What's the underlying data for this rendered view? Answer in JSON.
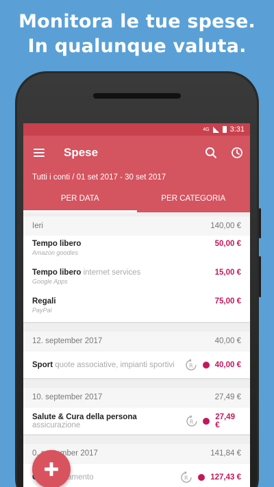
{
  "promo": {
    "line1": "Monitora le tue spese.",
    "line2": "In qualunque valuta."
  },
  "status": {
    "network": "4G",
    "time": "3:31"
  },
  "toolbar": {
    "title": "Spese",
    "subtitle": "Tutti i conti / 01 set 2017 - 30 set 2017"
  },
  "tabs": [
    {
      "label": "PER DATA",
      "active": true
    },
    {
      "label": "PER CATEGORIA",
      "active": false
    }
  ],
  "groups": [
    {
      "date": "Ieri",
      "total": "140,00 €",
      "items": [
        {
          "category": "Tempo libero",
          "description": "",
          "account": "Amazon goodies",
          "amount": "50,00 €"
        },
        {
          "category": "Tempo libero",
          "description": "internet services",
          "account": "Google Apps",
          "amount": "15,00 €"
        },
        {
          "category": "Regali",
          "description": "",
          "account": "PayPal",
          "amount": "75,00 €"
        }
      ]
    },
    {
      "date": "12. september 2017",
      "total": "40,00 €",
      "items": [
        {
          "category": "Sport",
          "description": "quote associative, impianti sportivi",
          "amount": "40,00 €"
        }
      ]
    },
    {
      "date": "10. september 2017",
      "total": "27,49 €",
      "items": [
        {
          "category": "Salute & Cura della persona",
          "description": "assicurazione",
          "amount": "27,49 €"
        }
      ]
    },
    {
      "date": "0. september 2017",
      "total": "141,84 €",
      "items": [
        {
          "category": "Ca",
          "description": "riscaldamento",
          "amount": "127,43 €"
        }
      ]
    }
  ],
  "colors": {
    "appbar": "#d45460",
    "statusbar": "#c9414d",
    "amount": "#c2185b",
    "background": "#5aa0d6",
    "fab": "#d9535f"
  },
  "icons": {
    "menu": "hamburger-icon",
    "search": "search-icon",
    "history": "clock-icon",
    "recurring": "recurring-icon",
    "fab": "plus-icon"
  }
}
